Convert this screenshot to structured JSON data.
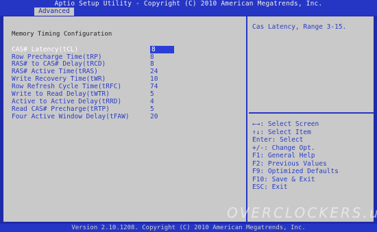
{
  "title": "Aptio Setup Utility - Copyright (C) 2010 American Megatrends, Inc.",
  "tabs": [
    {
      "label": "Advanced",
      "active": true
    }
  ],
  "section_title": "Memory Timing Configuration",
  "settings": [
    {
      "label": "CAS# Latency(tCL)",
      "value": "8",
      "selected": true
    },
    {
      "label": "Row Precharge Time(tRP)",
      "value": "8"
    },
    {
      "label": "RAS# to CAS# Delay(tRCD)",
      "value": "8"
    },
    {
      "label": "RAS# Active Time(tRAS)",
      "value": "24"
    },
    {
      "label": "Write Recovery Time(tWR)",
      "value": "10"
    },
    {
      "label": "Row Refresh Cycle Time(tRFC)",
      "value": "74"
    },
    {
      "label": "Write to Read Delay(tWTR)",
      "value": "5"
    },
    {
      "label": "Active to Active Delay(tRRD)",
      "value": "4"
    },
    {
      "label": "Read CAS# Precharge(tRTP)",
      "value": "5"
    },
    {
      "label": "Four Active Window Delay(tFAW)",
      "value": "20"
    }
  ],
  "help": "Cas Latency, Range 3-15.",
  "key_help": [
    "←→: Select Screen",
    "↑↓: Select Item",
    "Enter: Select",
    "+/-: Change Opt.",
    "F1: General Help",
    "F2: Previous Values",
    "F9: Optimized Defaults",
    "F10: Save & Exit",
    "ESC: Exit"
  ],
  "watermark": "OVERCLOCKERS.ua",
  "footer": "Version 2.10.1208. Copyright (C) 2010 American Megatrends, Inc.",
  "colors": {
    "background": "#1e2aa8",
    "panel": "#c9c9c9",
    "text": "#2a3cc4",
    "highlight": "#2b3fd6"
  }
}
